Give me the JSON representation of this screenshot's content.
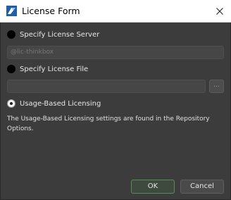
{
  "window": {
    "title": "License Form",
    "icon": "thinkbox-logo-icon"
  },
  "options": [
    {
      "label": "Specify License Server",
      "checked": false
    },
    {
      "label": "Specify License File",
      "checked": false
    },
    {
      "label": "Usage-Based Licensing",
      "checked": true
    }
  ],
  "license_server": {
    "placeholder": "@lic-thinkbox",
    "value": ""
  },
  "license_file": {
    "value": "",
    "browse_label": "..."
  },
  "info": "The Usage-Based Licensing settings are found in the Repository Options.",
  "buttons": {
    "ok": "OK",
    "cancel": "Cancel"
  },
  "colors": {
    "background": "#3c3c3c",
    "ok_border": "#5a8a5a"
  }
}
